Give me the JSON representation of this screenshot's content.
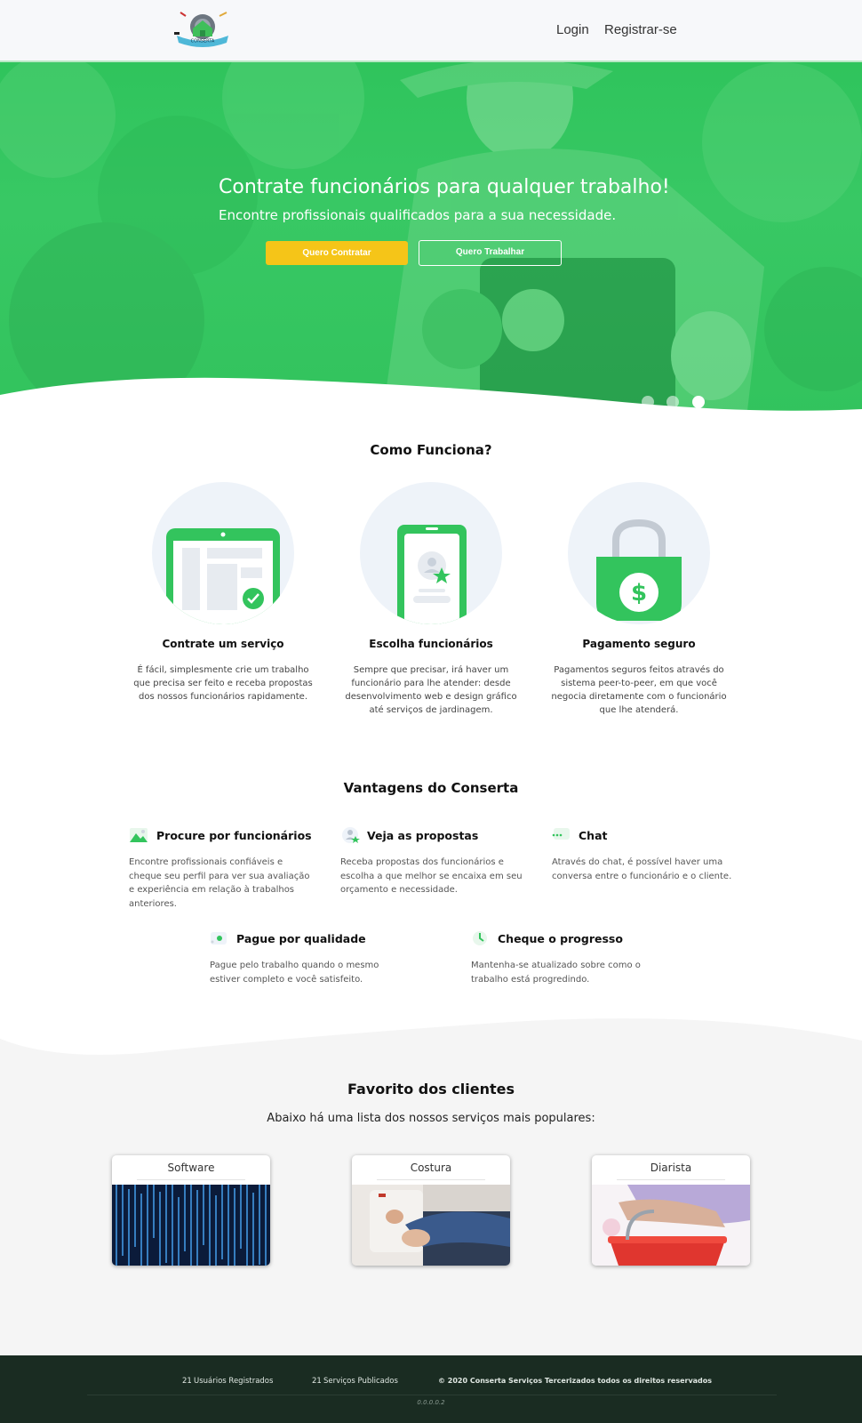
{
  "header": {
    "logo_text": "CONSERTA",
    "nav": {
      "login": "Login",
      "register": "Registrar-se"
    }
  },
  "hero": {
    "title": "Contrate funcionários para qualquer trabalho!",
    "subtitle": "Encontre profissionais qualificados para a sua necessidade.",
    "hire_button": "Quero Contratar",
    "work_button": "Quero Trabalhar",
    "carousel_active_index": 2,
    "carousel_count": 3
  },
  "how": {
    "title": "Como Funciona?",
    "steps": [
      {
        "icon": "tablet-check-icon",
        "title": "Contrate um serviço",
        "text": "É fácil, simplesmente crie um trabalho que precisa ser feito e receba propostas dos nossos funcionários rapidamente."
      },
      {
        "icon": "phone-profile-star-icon",
        "title": "Escolha funcionários",
        "text": "Sempre que precisar, irá haver um funcionário para lhe atender: desde desenvolvimento web e design gráfico até serviços de jardinagem."
      },
      {
        "icon": "shopping-bag-dollar-icon",
        "title": "Pagamento seguro",
        "text": "Pagamentos seguros feitos através do sistema peer-to-peer, em que você negocia diretamente com o funcionário que lhe atenderá."
      }
    ]
  },
  "advantages": {
    "title": "Vantagens do Conserta",
    "items": [
      {
        "icon": "landscape-image-icon",
        "title": "Procure por funcionários",
        "text": "Encontre profissionais confiáveis e cheque seu perfil para ver sua avaliação e experiência em relação à trabalhos anteriores."
      },
      {
        "icon": "user-star-icon",
        "title": "Veja as propostas",
        "text": "Receba propostas dos funcionários e escolha a que melhor se encaixa em seu orçamento e necessidade."
      },
      {
        "icon": "chat-bubble-icon",
        "title": "Chat",
        "text": "Através do chat, é possível haver uma conversa entre o funcionário e o cliente."
      },
      {
        "icon": "quality-coin-icon",
        "title": "Pague por qualidade",
        "text": "Pague pelo trabalho quando o mesmo estiver completo e você satisfeito."
      },
      {
        "icon": "progress-clock-icon",
        "title": "Cheque o progresso",
        "text": "Mantenha-se atualizado sobre como o trabalho está progredindo."
      }
    ]
  },
  "favorites": {
    "title": "Favorito dos clientes",
    "subtitle": "Abaixo há uma lista dos nossos serviços mais populares:",
    "cards": [
      {
        "label": "Software"
      },
      {
        "label": "Costura"
      },
      {
        "label": "Diarista"
      }
    ]
  },
  "footer": {
    "users_count": "21",
    "users_label": "Usuários Registrados",
    "services_count": "21",
    "services_label": "Serviços Publicados",
    "copyright": "© 2020 Conserta Serviços Tercerizados todos os direitos reservados",
    "version": "0.0.0.0.2"
  },
  "colors": {
    "brand_green": "#33c45d",
    "accent_yellow": "#f5c518",
    "footer_bg": "#1a2c22"
  }
}
